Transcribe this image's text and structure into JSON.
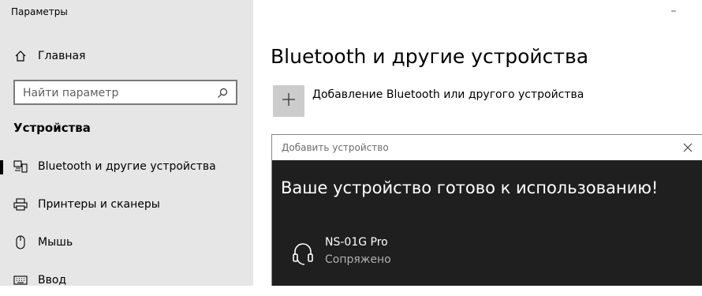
{
  "window": {
    "title": "Параметры",
    "minimize_glyph": "–"
  },
  "sidebar": {
    "home_label": "Главная",
    "search_placeholder": "Найти параметр",
    "section_title": "Устройства",
    "items": [
      {
        "label": "Bluetooth и другие устройства",
        "icon": "bluetooth-devices-icon",
        "active": true
      },
      {
        "label": "Принтеры и сканеры",
        "icon": "printer-icon",
        "active": false
      },
      {
        "label": "Мышь",
        "icon": "mouse-icon",
        "active": false
      },
      {
        "label": "Ввод",
        "icon": "keyboard-icon",
        "active": false
      }
    ]
  },
  "main": {
    "title": "Bluetooth и другие устройства",
    "add_label": "Добавление Bluetooth или другого устройства"
  },
  "dialog": {
    "title": "Добавить устройство",
    "heading": "Ваше устройство готово к использованию!",
    "device": {
      "name": "NS-01G Pro",
      "status": "Сопряжено",
      "icon": "headset-icon"
    }
  },
  "colors": {
    "sidebar_bg": "#e6e6e6",
    "dialog_bg": "#1f1f1f",
    "add_button_bg": "#cccccc"
  }
}
